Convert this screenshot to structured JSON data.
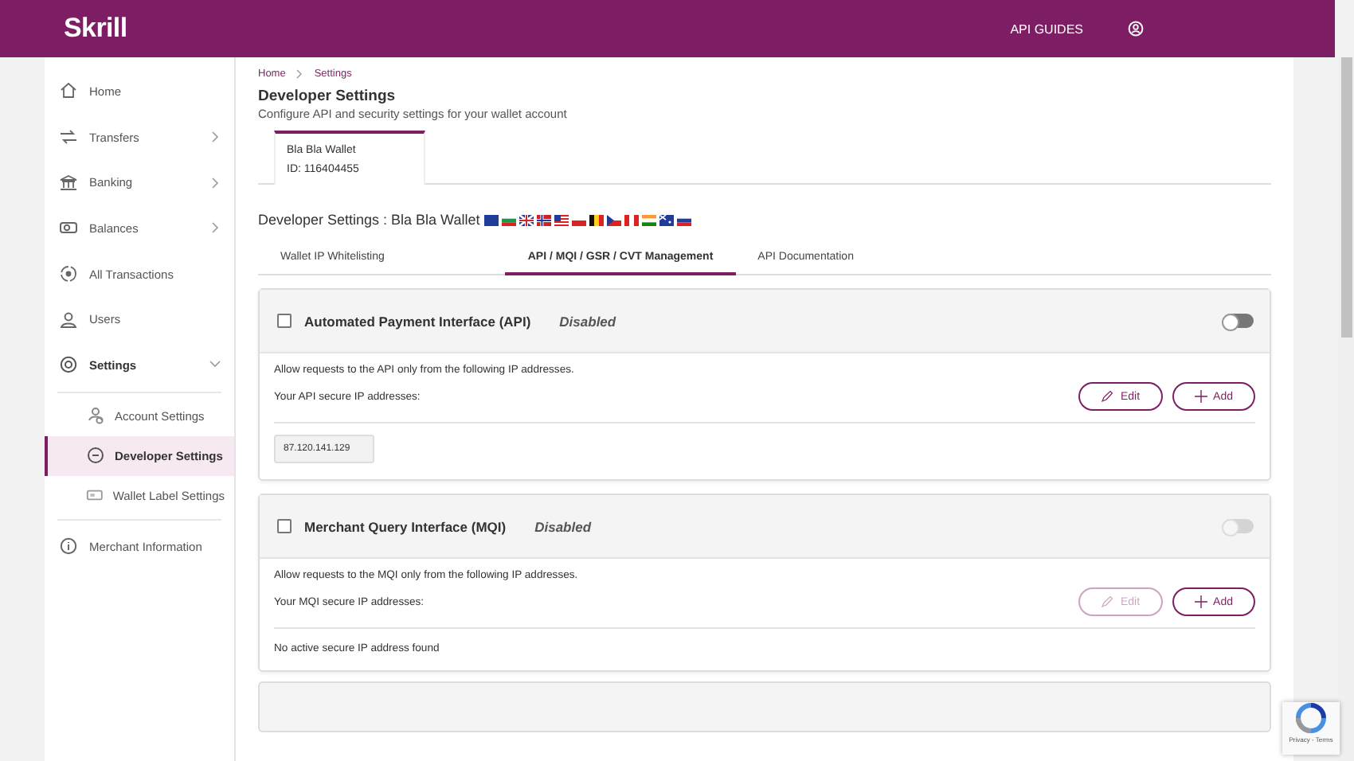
{
  "header": {
    "logo": "Skrill",
    "links": [
      "API GUIDES"
    ]
  },
  "sidebar": {
    "items": [
      {
        "label": "Home",
        "expandable": false,
        "expanded": false,
        "selected": false
      },
      {
        "label": "Transfers",
        "expandable": true,
        "expanded": false,
        "selected": false
      },
      {
        "label": "Banking",
        "expandable": true,
        "expanded": false,
        "selected": false
      },
      {
        "label": "Balances",
        "expandable": true,
        "expanded": false,
        "selected": false
      },
      {
        "label": "All Transactions",
        "expandable": false,
        "expanded": false,
        "selected": false
      },
      {
        "label": "Users",
        "expandable": false,
        "expanded": false,
        "selected": false
      },
      {
        "label": "Settings",
        "expandable": true,
        "expanded": true,
        "selected": false,
        "children": [
          {
            "label": "Account Settings",
            "selected": false
          },
          {
            "label": "Developer Settings",
            "selected": true
          },
          {
            "label": "Wallet Label Settings",
            "selected": false
          }
        ]
      },
      {
        "label": "Merchant Information",
        "expandable": false,
        "expanded": false,
        "selected": false
      }
    ]
  },
  "breadcrumb": [
    "Home",
    "Settings"
  ],
  "page": {
    "title": "Developer Settings",
    "subtitle": "Configure API and security settings for your wallet account"
  },
  "wallets": [
    {
      "name": "Bla Bla Wallet",
      "id": "ID: 116404455",
      "selected": true
    }
  ],
  "section_title": "Developer Settings : Bla Bla Wallet",
  "tabs": [
    {
      "label": "Wallet IP Whitelisting",
      "selected": false
    },
    {
      "label": "API / MQI / GSR / CVT Management",
      "selected": true
    },
    {
      "label": "API Documentation",
      "selected": false
    }
  ],
  "interfaces": [
    {
      "name": "Automated Payment Interface (API)",
      "status": "Disabled",
      "checked": false,
      "on": false,
      "toggle_disabled": false,
      "description": "Allow requests to the API only from the following IP addresses.",
      "ip_label": "Your API secure IP addresses:",
      "edit": {
        "label": "Edit",
        "disabled": false
      },
      "add": {
        "label": "Add"
      },
      "ips": [
        "87.120.141.129"
      ]
    },
    {
      "name": "Merchant Query Interface (MQI)",
      "status": "Disabled",
      "checked": false,
      "on": false,
      "toggle_disabled": true,
      "description": "Allow requests to the MQI only from the following IP addresses.",
      "ip_label": "Your MQI secure IP addresses:",
      "edit": {
        "label": "Edit",
        "disabled": true
      },
      "add": {
        "label": "Add"
      },
      "empty_message": "No active secure IP address found"
    }
  ],
  "recaptcha": {
    "text": "Privacy - Terms"
  }
}
